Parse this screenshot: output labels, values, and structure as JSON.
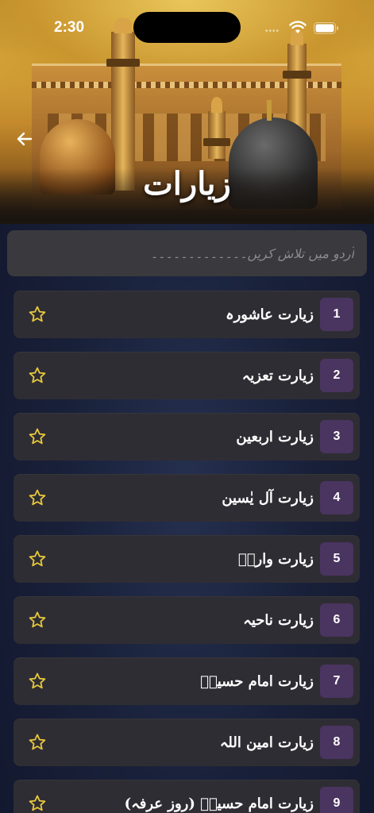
{
  "status_bar": {
    "time": "2:30"
  },
  "header": {
    "title": "زیارات",
    "back_icon": "arrow-left-icon"
  },
  "search": {
    "placeholder": "اُردو میں تلاش کریں۔۔۔۔۔۔۔۔۔۔۔۔۔",
    "value": ""
  },
  "colors": {
    "card_bg": "#2f2d34",
    "badge_bg": "#4a3460",
    "star": "#e8c93a",
    "background": "#19213a"
  },
  "items": [
    {
      "number": "1",
      "title": "زیارت عاشورہ",
      "favorite_icon": "star-outline-icon"
    },
    {
      "number": "2",
      "title": "زیارت تعزیہ",
      "favorite_icon": "star-outline-icon"
    },
    {
      "number": "3",
      "title": "زیارت اربعین",
      "favorite_icon": "star-outline-icon"
    },
    {
      "number": "4",
      "title": "زیارت آل یٰسین",
      "favorite_icon": "star-outline-icon"
    },
    {
      "number": "5",
      "title": "زیارت وارثؑ",
      "favorite_icon": "star-outline-icon"
    },
    {
      "number": "6",
      "title": "زیارت ناحیہ",
      "favorite_icon": "star-outline-icon"
    },
    {
      "number": "7",
      "title": "زیارت امام حسینؑ",
      "favorite_icon": "star-outline-icon"
    },
    {
      "number": "8",
      "title": "زیارت امین اللہ",
      "favorite_icon": "star-outline-icon"
    },
    {
      "number": "9",
      "title": "زیارت امام حسینؑ (روز عرفہ)",
      "favorite_icon": "star-outline-icon"
    }
  ]
}
